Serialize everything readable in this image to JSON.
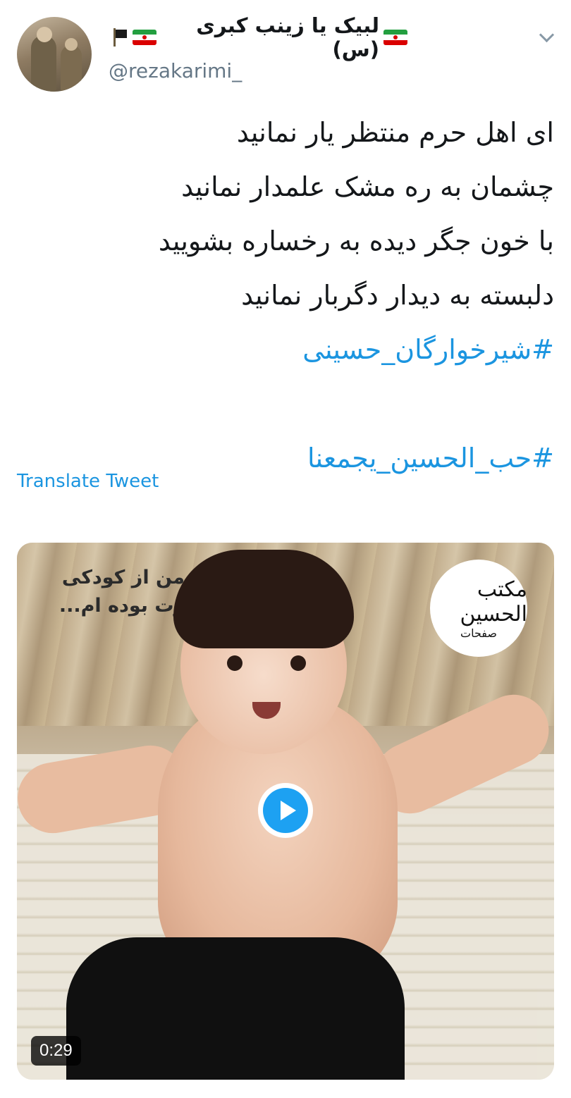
{
  "tweet": {
    "display_name": "لبیک یا زینب کبری (س)",
    "handle": "@rezakarimi_",
    "lines": [
      "ای اهل حرم منتظر یار نمانید",
      "چشمان به ره مشک علمدار نمانید",
      "با خون جگر دیده به رخساره بشویید",
      "دلبسته به دیدار دگربار نمانید"
    ],
    "hashtags": [
      "#شیرخوارگان_حسینی",
      "#حب_الحسین_یجمعنا"
    ],
    "translate_label": "Translate Tweet"
  },
  "media": {
    "overlay_text": [
      "من از کودکی",
      "رت بوده ام..."
    ],
    "logo_line1": "مکتب الحسین",
    "logo_line2": "صفحات",
    "duration": "0:29"
  },
  "icons": {
    "caret": "chevron-down-icon",
    "play": "play-icon",
    "flag": "iran-flag-icon",
    "black_flag": "black-flag-icon"
  },
  "colors": {
    "link": "#1b95e0",
    "play_button": "#1da1f2",
    "handle": "#657786"
  }
}
